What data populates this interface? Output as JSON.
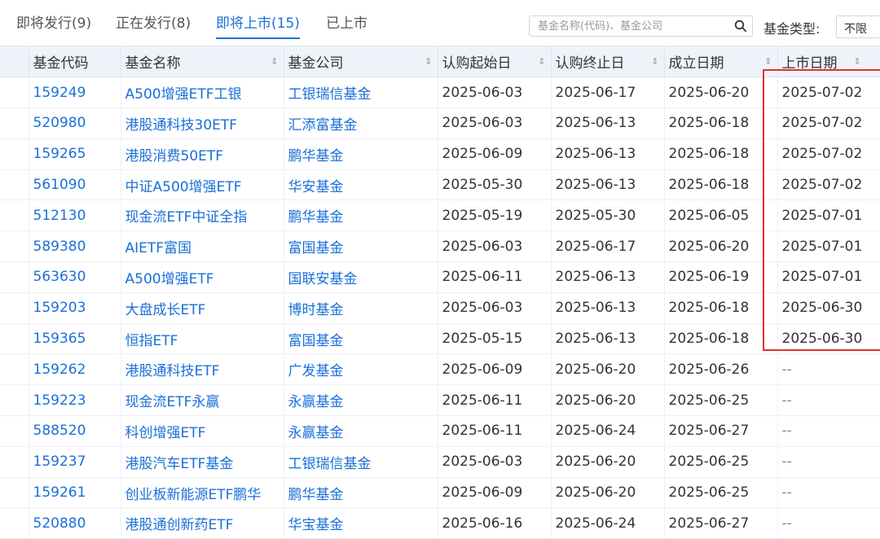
{
  "tabs": [
    {
      "label": "即将发行(9)",
      "active": false
    },
    {
      "label": "正在发行(8)",
      "active": false
    },
    {
      "label": "即将上市(15)",
      "active": true
    },
    {
      "label": "已上市",
      "active": false
    }
  ],
  "search": {
    "placeholder": "基金名称(代码)、基金公司"
  },
  "fund_type": {
    "label": "基金类型:",
    "value": "不限"
  },
  "table": {
    "headers": [
      "基金代码",
      "基金名称",
      "基金公司",
      "认购起始日",
      "认购终止日",
      "成立日期",
      "上市日期"
    ],
    "rows": [
      [
        "159249",
        "A500增强ETF工银",
        "工银瑞信基金",
        "2025-06-03",
        "2025-06-17",
        "2025-06-20",
        "2025-07-02"
      ],
      [
        "520980",
        "港股通科技30ETF",
        "汇添富基金",
        "2025-06-03",
        "2025-06-13",
        "2025-06-18",
        "2025-07-02"
      ],
      [
        "159265",
        "港股消费50ETF",
        "鹏华基金",
        "2025-06-09",
        "2025-06-13",
        "2025-06-18",
        "2025-07-02"
      ],
      [
        "561090",
        "中证A500增强ETF",
        "华安基金",
        "2025-05-30",
        "2025-06-13",
        "2025-06-18",
        "2025-07-02"
      ],
      [
        "512130",
        "现金流ETF中证全指",
        "鹏华基金",
        "2025-05-19",
        "2025-05-30",
        "2025-06-05",
        "2025-07-01"
      ],
      [
        "589380",
        "AIETF富国",
        "富国基金",
        "2025-06-03",
        "2025-06-17",
        "2025-06-20",
        "2025-07-01"
      ],
      [
        "563630",
        "A500增强ETF",
        "国联安基金",
        "2025-06-11",
        "2025-06-13",
        "2025-06-19",
        "2025-07-01"
      ],
      [
        "159203",
        "大盘成长ETF",
        "博时基金",
        "2025-06-03",
        "2025-06-13",
        "2025-06-18",
        "2025-06-30"
      ],
      [
        "159365",
        "恒指ETF",
        "富国基金",
        "2025-05-15",
        "2025-06-13",
        "2025-06-18",
        "2025-06-30"
      ],
      [
        "159262",
        "港股通科技ETF",
        "广发基金",
        "2025-06-09",
        "2025-06-20",
        "2025-06-26",
        "--"
      ],
      [
        "159223",
        "现金流ETF永赢",
        "永赢基金",
        "2025-06-11",
        "2025-06-20",
        "2025-06-25",
        "--"
      ],
      [
        "588520",
        "科创增强ETF",
        "永赢基金",
        "2025-06-11",
        "2025-06-24",
        "2025-06-27",
        "--"
      ],
      [
        "159237",
        "港股汽车ETF基金",
        "工银瑞信基金",
        "2025-06-03",
        "2025-06-20",
        "2025-06-25",
        "--"
      ],
      [
        "159261",
        "创业板新能源ETF鹏华",
        "鹏华基金",
        "2025-06-09",
        "2025-06-20",
        "2025-06-25",
        "--"
      ],
      [
        "520880",
        "港股通创新药ETF",
        "华宝基金",
        "2025-06-16",
        "2025-06-24",
        "2025-06-27",
        "--"
      ]
    ]
  },
  "colors": {
    "accent": "#1a6fd8",
    "highlight": "#e0332f",
    "header_bg": "#eef3fa"
  }
}
